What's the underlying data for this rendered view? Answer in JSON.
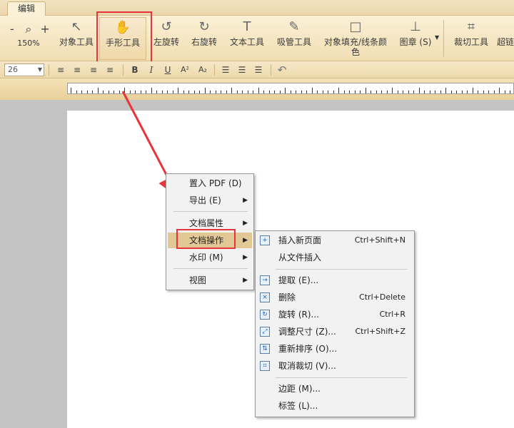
{
  "tab": {
    "label": "编辑"
  },
  "ribbon": {
    "zoom": {
      "minus": "-",
      "plus": "+",
      "value": "150%"
    },
    "tools": [
      {
        "name": "object-tool",
        "label": "对象工具",
        "icon": "↖"
      },
      {
        "name": "hand-tool",
        "label": "手形工具",
        "icon": "✋"
      },
      {
        "name": "rotate-left",
        "label": "左旋转",
        "icon": "↺"
      },
      {
        "name": "rotate-right",
        "label": "右旋转",
        "icon": "↻"
      },
      {
        "name": "text-tool",
        "label": "文本工具",
        "icon": "T"
      },
      {
        "name": "eyedropper-tool",
        "label": "吸管工具",
        "icon": "✎"
      },
      {
        "name": "fill-color",
        "label": "对象填充/线条颜色",
        "icon": "□"
      },
      {
        "name": "stamp",
        "label": "图章 (S)",
        "icon": "⊥"
      },
      {
        "name": "crop-tool",
        "label": "裁切工具",
        "icon": "⌗"
      },
      {
        "name": "crop-partial",
        "label": "超链",
        "icon": ""
      }
    ]
  },
  "format": {
    "font_size": "26",
    "align_left": "≡",
    "align_center": "≡",
    "align_right": "≡",
    "justify": "≡",
    "bold": "B",
    "italic": "I",
    "underline": "U",
    "superscript": "A²",
    "subscript": "A₂",
    "list1": "☰",
    "list2": "☰",
    "list3": "☰",
    "undo": "↶"
  },
  "menu_main": {
    "items": [
      {
        "label": "置入 PDF (D)",
        "submenu": false
      },
      {
        "label": "导出 (E)",
        "submenu": true
      },
      {
        "label": "文档属性",
        "submenu": true
      },
      {
        "label": "文档操作",
        "submenu": true
      },
      {
        "label": "水印 (M)",
        "submenu": true
      },
      {
        "label": "视图",
        "submenu": true
      }
    ],
    "arrow": "▶"
  },
  "menu_sub": {
    "items": [
      {
        "label": "插入新页面",
        "shortcut": "Ctrl+Shift+N",
        "icon": "+"
      },
      {
        "label": "从文件插入",
        "shortcut": "",
        "icon": ""
      },
      {
        "label": "提取 (E)...",
        "shortcut": "",
        "icon": "→"
      },
      {
        "label": "删除",
        "shortcut": "Ctrl+Delete",
        "icon": "×"
      },
      {
        "label": "旋转 (R)...",
        "shortcut": "Ctrl+R",
        "icon": "↻"
      },
      {
        "label": "调整尺寸 (Z)...",
        "shortcut": "Ctrl+Shift+Z",
        "icon": "⤢"
      },
      {
        "label": "重新排序 (O)...",
        "shortcut": "",
        "icon": "⇅"
      },
      {
        "label": "取消裁切 (V)...",
        "shortcut": "",
        "icon": "⌗"
      },
      {
        "label": "边距 (M)...",
        "shortcut": "",
        "icon": ""
      },
      {
        "label": "标签 (L)...",
        "shortcut": "",
        "icon": ""
      }
    ]
  },
  "colors": {
    "highlight": "#e8343a",
    "menu_hover": "#e1c895",
    "ribbon": "#f1deb3"
  }
}
